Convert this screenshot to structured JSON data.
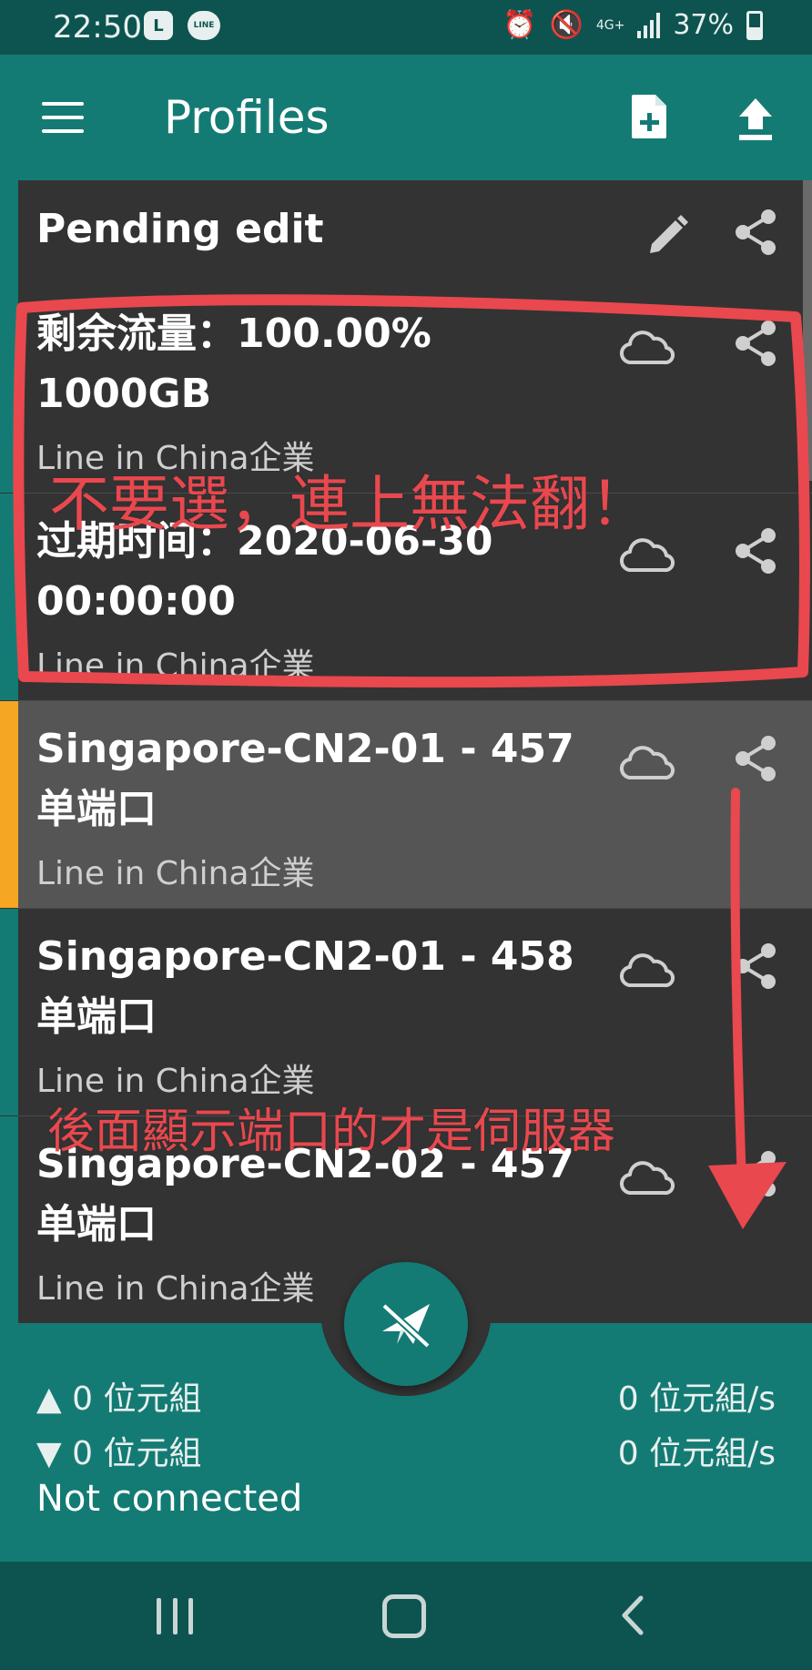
{
  "status_bar": {
    "time": "22:50",
    "badge_1": "L",
    "badge_2": "LINE",
    "network": "4G+",
    "battery": "37%"
  },
  "app_bar": {
    "title": "Profiles"
  },
  "header_row": {
    "title": "Pending edit"
  },
  "profiles": [
    {
      "title": "剩余流量：100.00% 1000GB",
      "group": "Line in China企業",
      "selected": false
    },
    {
      "title": "过期时间：2020-06-30 00:00:00",
      "group": "Line in China企業",
      "selected": false
    },
    {
      "title": "Singapore-CN2-01 - 457 单端口",
      "group": "Line in China企業",
      "selected": true
    },
    {
      "title": "Singapore-CN2-01 - 458 单端口",
      "group": "Line in China企業",
      "selected": false
    },
    {
      "title": "Singapore-CN2-02 - 457 单端口",
      "group": "Line in China企業",
      "selected": false
    }
  ],
  "traffic": {
    "up_total": "▲ 0 位元組",
    "down_total": "▼ 0 位元組",
    "up_rate": "0 位元組/s",
    "down_rate": "0 位元組/s"
  },
  "connection_status": "Not connected",
  "annotations": {
    "note_1": "不要選，連上無法翻！",
    "note_2": "後面顯示端口的才是伺服器"
  },
  "colors": {
    "primary": "#147b74",
    "primary_dark": "#0d5450",
    "selected_accent": "#f5a623",
    "annotation": "#e8484e"
  }
}
